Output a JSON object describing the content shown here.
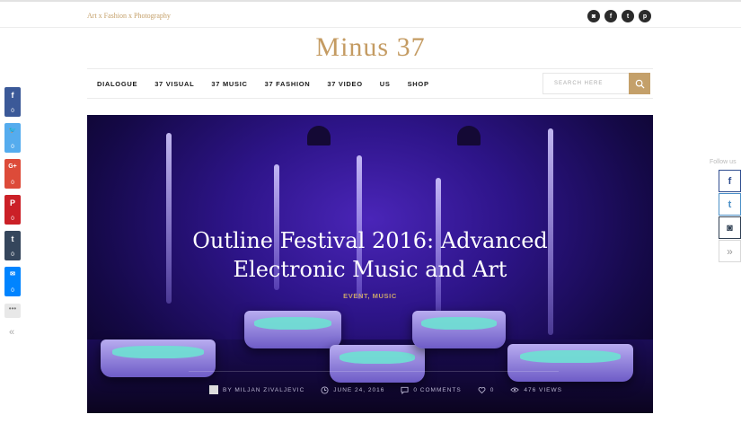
{
  "topbar": {
    "tagline": "Art x Fashion x Photography",
    "social": [
      {
        "icon": "instagram-icon",
        "glyph": "◙"
      },
      {
        "icon": "facebook-icon",
        "glyph": "f"
      },
      {
        "icon": "twitter-icon",
        "glyph": "t"
      },
      {
        "icon": "pinterest-icon",
        "glyph": "p"
      }
    ]
  },
  "logo": "Minus 37",
  "nav": {
    "items": [
      "DIALOGUE",
      "37 VISUAL",
      "37 MUSIC",
      "37 FASHION",
      "37 VIDEO",
      "US",
      "SHOP"
    ],
    "search_placeholder": "SEARCH HERE"
  },
  "hero": {
    "title_line1": "Outline Festival 2016: Advanced",
    "title_line2": "Electronic Music and Art",
    "categories": "EVENT, MUSIC",
    "author": "BY MILJAN ZIVALJEVIC",
    "date": "JUNE 24, 2016",
    "comments": "0 COMMENTS",
    "likes": "0",
    "views": "476 VIEWS"
  },
  "share_bar": {
    "buttons": [
      {
        "icon": "facebook-icon",
        "glyph": "f",
        "count": "0",
        "color": "#3b5998"
      },
      {
        "icon": "twitter-icon",
        "glyph": "🐦",
        "count": "0",
        "color": "#55acee"
      },
      {
        "icon": "google-plus-icon",
        "glyph": "G+",
        "count": "0",
        "color": "#dd4b39"
      },
      {
        "icon": "pinterest-icon",
        "glyph": "P",
        "count": "0",
        "color": "#cb2027"
      },
      {
        "icon": "tumblr-icon",
        "glyph": "t",
        "count": "0",
        "color": "#35465c"
      },
      {
        "icon": "messenger-icon",
        "glyph": "✉",
        "count": "0",
        "color": "#0084ff"
      }
    ],
    "more": "•••",
    "collapse": "«"
  },
  "follow": {
    "label": "Follow us",
    "buttons": [
      {
        "icon": "facebook-icon",
        "glyph": "f"
      },
      {
        "icon": "twitter-icon",
        "glyph": "t"
      },
      {
        "icon": "instagram-icon",
        "glyph": "◙"
      }
    ],
    "expand": "»"
  },
  "colors": {
    "accent": "#c4a06a",
    "hero_purple": "#2d1488",
    "water": "#6fe0d2"
  }
}
